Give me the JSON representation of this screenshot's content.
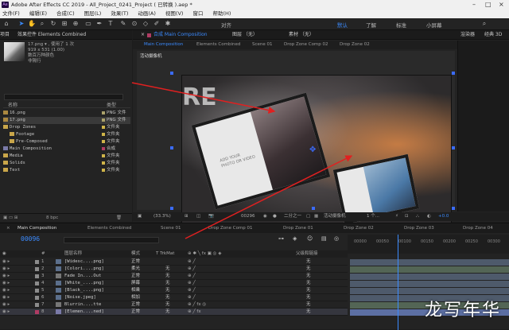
{
  "titlebar": {
    "text": "Adobe After Effects CC 2019 - All_Project_0241_Project ( 已转换 ).aep *",
    "logo": "Ae"
  },
  "menubar": [
    "文件(F)",
    "编辑(E)",
    "合成(C)",
    "图层(L)",
    "效果(T)",
    "动画(A)",
    "视图(V)",
    "窗口",
    "帮助(H)"
  ],
  "toolbar": {
    "align": "对齐",
    "workspaces": [
      "默认",
      "了解",
      "标准",
      "小屏幕"
    ]
  },
  "project": {
    "tabs": [
      "项目",
      "效果控件 Elements Combined"
    ],
    "thumb_info": [
      "17.png ▾ , 使用了 1 次",
      "919 x 531 (1.00)",
      "数百万种颜色",
      "非隔行"
    ],
    "headers": {
      "name": "名称",
      "type": "类型"
    },
    "rows": [
      {
        "name": "16.png",
        "type": "PNG 文件",
        "color": "#aaa16b"
      },
      {
        "name": "17.png",
        "type": "PNG 文件",
        "color": "#aaa16b"
      },
      {
        "name": "Drop Zones",
        "type": "文件夹",
        "color": "#cfb449"
      },
      {
        "name": "Footage",
        "type": "文件夹",
        "color": "#cfb449"
      },
      {
        "name": "Pre-Composed",
        "type": "文件夹",
        "color": "#cfb449"
      },
      {
        "name": "Main Composition",
        "type": "合成",
        "color": "#b03b63"
      },
      {
        "name": "Media",
        "type": "文件夹",
        "color": "#cfb449"
      },
      {
        "name": "Solids",
        "type": "文件夹",
        "color": "#cfb449"
      },
      {
        "name": "Text",
        "type": "文件夹",
        "color": "#cfb449"
      }
    ],
    "footer": "8 bpc"
  },
  "comp": {
    "tabs": [
      "合成 Main Composition",
      "图层 （无）",
      "素材 （无）",
      "渲染器",
      "经典 3D"
    ],
    "subtabs": [
      "Main Composition",
      "Elements Combined",
      "Scene 01",
      "Drop Zone Comp 02",
      "Drop Zone 02"
    ],
    "viewer_label": "活动摄像机",
    "card_text": [
      "ADD YOUR",
      "PHOTO OR VIDEO"
    ],
    "big_text": "RE",
    "bottom": {
      "zoom": "(33.3%)",
      "time": "00296",
      "resolution": "二分之一",
      "camera": "活动摄像机",
      "views": "1 个...",
      "exposure": "+0.0"
    }
  },
  "timeline": {
    "tabs": [
      "Main Composition",
      "Elements Combined",
      "Scene 01",
      "Drop Zone Comp 01",
      "Drop Zone 01",
      "Drop Zone 02",
      "Drop Zone 03",
      "Drop Zone 04"
    ],
    "timecode": "00096",
    "ruler": [
      "00000",
      "00050",
      "00100",
      "00150",
      "00200",
      "00250",
      "00300"
    ],
    "columns": {
      "name": "图层名称",
      "mode": "模式",
      "trk": "T TrkMat",
      "parent": "父级和链接"
    },
    "layers": [
      {
        "num": "1",
        "name": "[Widesc....png]",
        "mode": "正常",
        "trk": "",
        "parent": "无",
        "color": "#8c8c8c"
      },
      {
        "num": "2",
        "name": "[Colori....png]",
        "mode": "柔光",
        "trk": "无",
        "parent": "无",
        "color": "#8c8c8c"
      },
      {
        "num": "3",
        "name": "Fade In....Out",
        "mode": "正常",
        "trk": "无",
        "parent": "无",
        "color": "#8c8c8c"
      },
      {
        "num": "4",
        "name": "[White_....png]",
        "mode": "屏幕",
        "trk": "无",
        "parent": "无",
        "color": "#8c8c8c"
      },
      {
        "num": "5",
        "name": "[Black_....png]",
        "mode": "相乘",
        "trk": "无",
        "parent": "无",
        "color": "#8c8c8c"
      },
      {
        "num": "6",
        "name": "[Noise.jpeg]",
        "mode": "相加",
        "trk": "无",
        "parent": "无",
        "color": "#8c8c8c"
      },
      {
        "num": "7",
        "name": "Blurrin....tte",
        "mode": "正常",
        "trk": "无",
        "parent": "无",
        "color": "#8c8c8c"
      },
      {
        "num": "8",
        "name": "[Elemen....ned]",
        "mode": "正常",
        "trk": "无",
        "parent": "无",
        "color": "#b03b63"
      }
    ]
  },
  "watermark": "龙写年华"
}
